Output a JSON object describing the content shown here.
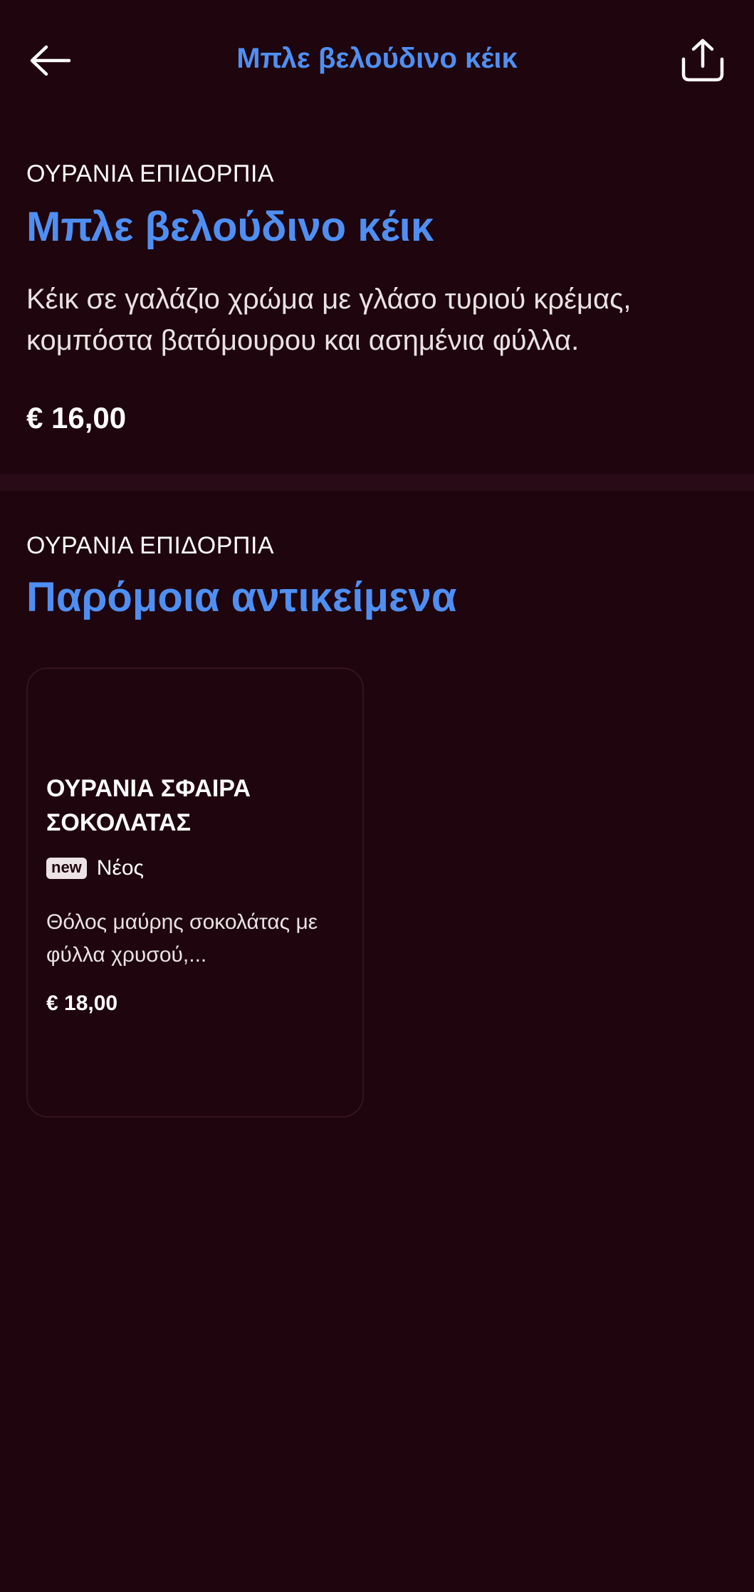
{
  "header": {
    "title": "Μπλε βελούδινο κέικ",
    "back_icon": "arrow-left-icon",
    "share_icon": "share-icon"
  },
  "product": {
    "category": "ΟΥΡΑΝΙΑ ΕΠΙΔΟΡΠΙΑ",
    "title": "Μπλε βελούδινο κέικ",
    "description": "Κέικ σε γαλάζιο χρώμα με γλάσο τυριού κρέμας, κομπόστα βατόμουρου και ασημένια φύλλα.",
    "price": "€ 16,00"
  },
  "similar": {
    "category": "ΟΥΡΑΝΙΑ ΕΠΙΔΟΡΠΙΑ",
    "title": "Παρόμοια αντικείμενα",
    "items": [
      {
        "title": "ΟΥΡΑΝΙΑ ΣΦΑΙΡΑ ΣΟΚΟΛΑΤΑΣ",
        "badge": "new",
        "badge_label": "Νέος",
        "description": "Θόλος μαύρης σοκολάτας με φύλλα χρυσού,...",
        "price": "€ 18,00"
      }
    ]
  },
  "colors": {
    "background": "#1f050d",
    "accent": "#4f8ff3",
    "divider": "#280b16",
    "text": "#ffffff"
  }
}
